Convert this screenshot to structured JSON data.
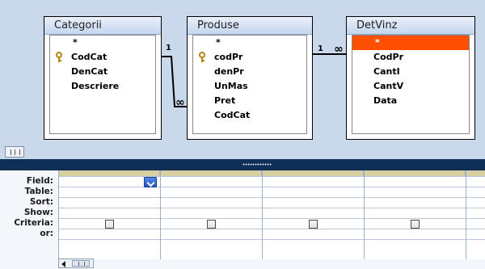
{
  "tables": [
    {
      "title": "Categorii",
      "fields": [
        "*",
        "CodCat",
        "DenCat",
        "Descriere"
      ],
      "key_index": 1
    },
    {
      "title": "Produse",
      "fields": [
        "*",
        "codPr",
        "denPr",
        "UnMas",
        "Pret",
        "CodCat"
      ],
      "key_index": 1
    },
    {
      "title": "DetVinz",
      "fields": [
        "*",
        "CodPr",
        "CantI",
        "CantV",
        "Data"
      ],
      "selected_index": 0
    }
  ],
  "relations": [
    {
      "one_label": "1",
      "many_label": "∞"
    },
    {
      "one_label": "1",
      "many_label": "∞"
    }
  ],
  "design_grid": {
    "row_labels": [
      "Field:",
      "Table:",
      "Sort:",
      "Show:",
      "Criteria:",
      "or:"
    ]
  },
  "colors": {
    "selected_field": "#ff4f00",
    "pane_background": "#c9d8eb",
    "splitter": "#0f2f57"
  },
  "icons": {
    "primary_key": "key-icon",
    "field_dropdown": "dropdown-arrow-icon",
    "scroll_left": "scroll-left-arrow-icon"
  }
}
